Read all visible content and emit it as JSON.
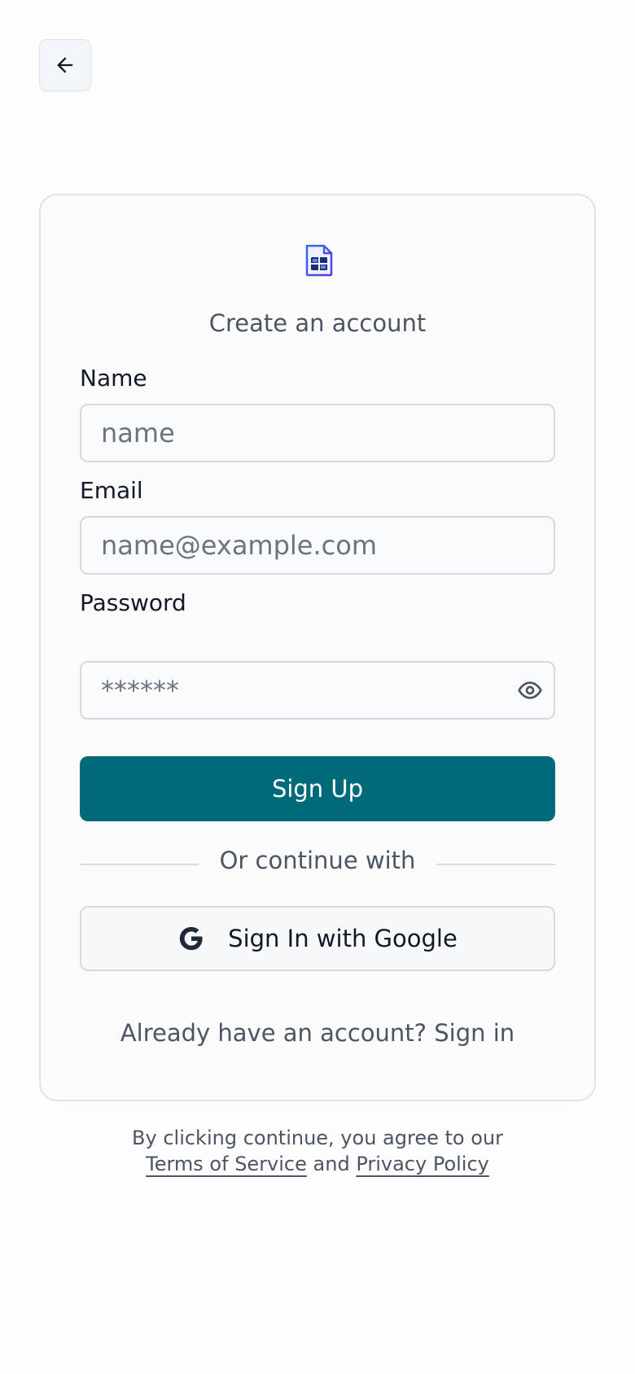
{
  "nav": {
    "back_icon": "arrow-left-icon"
  },
  "brand": {
    "logo_icon": "spreadsheet-document-icon",
    "logo_color": "#3b3ff0"
  },
  "form": {
    "subtitle": "Create an account",
    "name": {
      "label": "Name",
      "value": "",
      "placeholder": "name"
    },
    "email": {
      "label": "Email",
      "value": "",
      "placeholder": "name@example.com"
    },
    "password": {
      "label": "Password",
      "value": "",
      "placeholder": "******",
      "toggle_icon": "eye-icon"
    },
    "submit_label": "Sign Up",
    "divider_text": "Or continue with",
    "google": {
      "label": "Sign In with Google",
      "icon": "google-icon"
    },
    "signin_prompt": "Already have an account? Sign in"
  },
  "footer": {
    "line1": "By clicking continue, you agree to our",
    "terms_label": "Terms of Service",
    "and_text": "and",
    "privacy_label": "Privacy Policy"
  },
  "colors": {
    "primary": "#006a7b",
    "background": "#fdfdfd",
    "card": "#fbfbfc",
    "muted_text": "#4b5563"
  }
}
